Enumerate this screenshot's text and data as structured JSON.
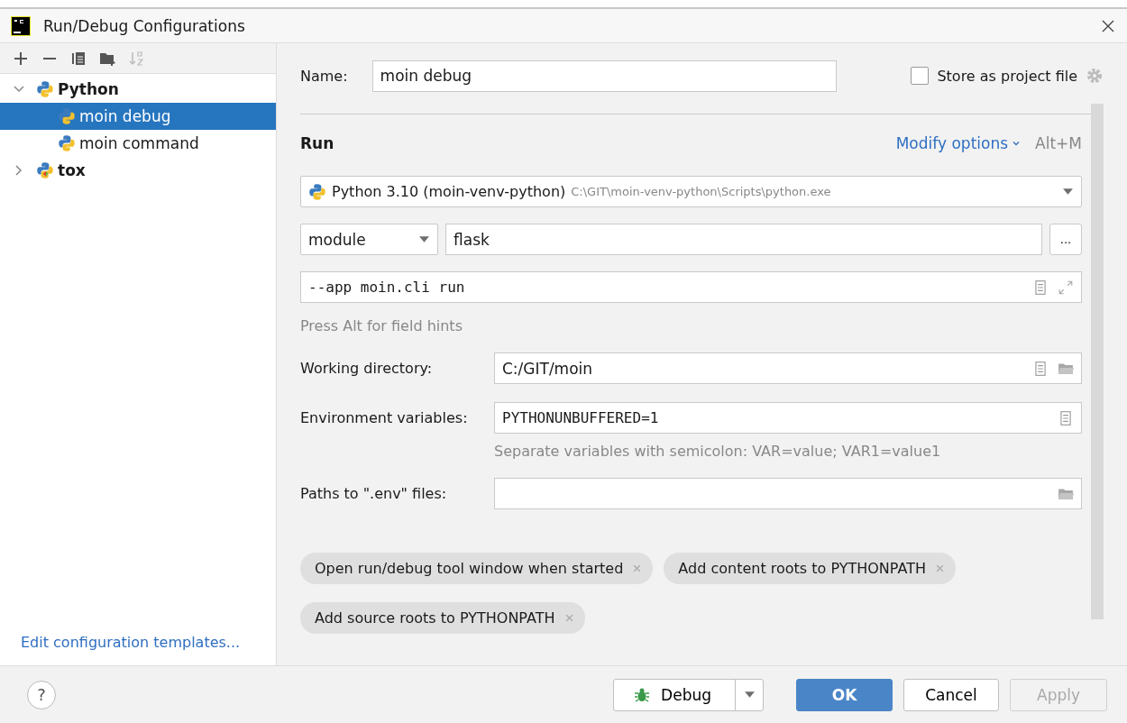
{
  "window": {
    "title": "Run/Debug Configurations"
  },
  "tree": [
    {
      "label": "Python",
      "kind": "python",
      "expanded": true,
      "selected": false,
      "children": [
        {
          "label": "moin debug",
          "kind": "python",
          "selected": true
        },
        {
          "label": "moin command",
          "kind": "python",
          "selected": false
        }
      ]
    },
    {
      "label": "tox",
      "kind": "tox",
      "expanded": false,
      "selected": false
    }
  ],
  "edit_templates_link": "Edit configuration templates...",
  "name_field": {
    "label": "Name:",
    "value": "moin debug"
  },
  "store_as_project_file": {
    "label": "Store as project file",
    "checked": false
  },
  "section": {
    "title": "Run",
    "modify_options": "Modify options",
    "shortcut": "Alt+M"
  },
  "interpreter": {
    "name": "Python 3.10 (moin-venv-python)",
    "path": "C:\\GIT\\moin-venv-python\\Scripts\\python.exe"
  },
  "target": {
    "type": "module",
    "value": "flask",
    "browse": "..."
  },
  "parameters": {
    "value": "--app moin.cli run"
  },
  "field_hint": "Press Alt for field hints",
  "working_directory": {
    "label": "Working directory:",
    "value": "C:/GIT/moin"
  },
  "environment_variables": {
    "label": "Environment variables:",
    "value": "PYTHONUNBUFFERED=1",
    "hint": "Separate variables with semicolon: VAR=value; VAR1=value1"
  },
  "env_files": {
    "label": "Paths to \".env\" files:"
  },
  "option_tags": [
    "Open run/debug tool window when started",
    "Add content roots to PYTHONPATH",
    "Add source roots to PYTHONPATH"
  ],
  "help": "?",
  "buttons": {
    "debug": "Debug",
    "ok": "OK",
    "cancel": "Cancel",
    "apply": {
      "label": "Apply",
      "disabled": true
    }
  }
}
